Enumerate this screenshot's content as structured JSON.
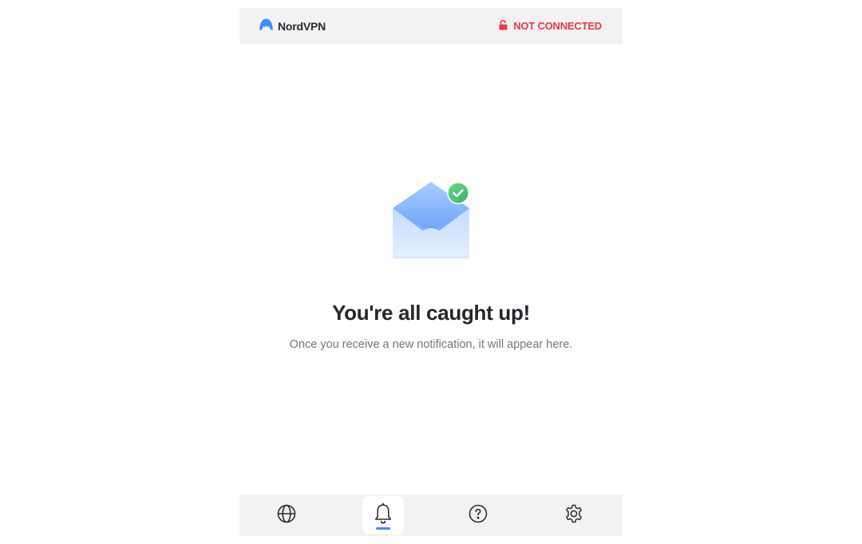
{
  "app": {
    "brand_name": "NordVPN",
    "brand_icon": "nordvpn-logo-icon",
    "accent_color": "#4687ff"
  },
  "header": {
    "status_label": "NOT CONNECTED",
    "status_icon": "unlocked-lock-icon",
    "status_color": "#f0364c"
  },
  "notifications": {
    "illustration_icon": "open-envelope-check-icon",
    "empty_title": "You're all caught up!",
    "empty_message": "Once you receive a new notification, it will appear here."
  },
  "bottom_nav": {
    "items": [
      {
        "icon": "globe-icon",
        "label": "Servers",
        "active": false
      },
      {
        "icon": "bell-icon",
        "label": "Notifications",
        "active": true
      },
      {
        "icon": "help-icon",
        "label": "Help",
        "active": false
      },
      {
        "icon": "gear-icon",
        "label": "Settings",
        "active": false
      }
    ]
  }
}
